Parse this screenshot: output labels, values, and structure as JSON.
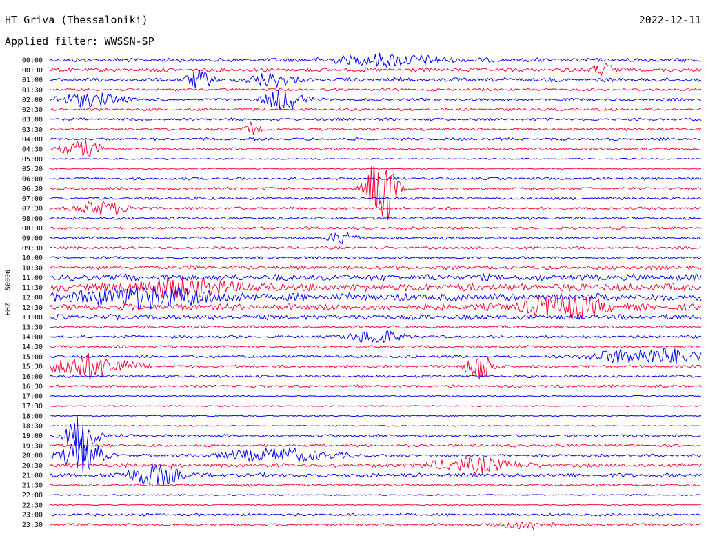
{
  "header": {
    "station": "HT Griva (Thessaloniki)",
    "date": "2022-12-11",
    "filter": "Applied filter: WWSSN-SP"
  },
  "chart_data": {
    "type": "line",
    "title": "HT Griva (Thessaloniki)",
    "subtitle": "Applied filter: WWSSN-SP",
    "date": "2022-12-11",
    "ylabel": "HHZ - 50000",
    "xlabel": "",
    "grid": false,
    "colors": [
      "#0000ff",
      "#ff0033"
    ],
    "rows": [
      "00:00",
      "00:30",
      "01:00",
      "01:30",
      "02:00",
      "02:30",
      "03:00",
      "03:30",
      "04:00",
      "04:30",
      "05:00",
      "05:30",
      "06:00",
      "06:30",
      "07:00",
      "07:30",
      "08:00",
      "08:30",
      "09:00",
      "09:30",
      "10:00",
      "10:30",
      "11:00",
      "11:30",
      "12:00",
      "12:30",
      "13:00",
      "13:30",
      "14:00",
      "14:30",
      "15:00",
      "15:30",
      "16:00",
      "16:30",
      "17:00",
      "17:30",
      "18:00",
      "18:30",
      "19:00",
      "19:30",
      "20:00",
      "20:30",
      "21:00",
      "21:30",
      "22:00",
      "22:30",
      "23:00",
      "23:30"
    ],
    "noise_level": [
      3,
      3,
      3,
      2,
      2,
      2,
      2,
      2,
      2,
      2,
      1,
      1,
      2,
      2,
      2,
      2,
      2,
      2,
      2,
      2,
      2,
      3,
      5,
      6,
      6,
      5,
      4,
      2,
      2,
      2,
      2,
      2,
      2,
      2,
      1,
      1,
      1,
      1,
      2,
      2,
      2,
      3,
      3,
      2,
      1,
      1,
      2,
      2
    ],
    "events": [
      {
        "row": 0,
        "t": 0.52,
        "amp": 8,
        "width": 0.08
      },
      {
        "row": 1,
        "t": 0.85,
        "amp": 8,
        "width": 0.02
      },
      {
        "row": 2,
        "t": 0.23,
        "amp": 12,
        "width": 0.02
      },
      {
        "row": 2,
        "t": 0.34,
        "amp": 10,
        "width": 0.03
      },
      {
        "row": 4,
        "t": 0.06,
        "amp": 10,
        "width": 0.05
      },
      {
        "row": 4,
        "t": 0.36,
        "amp": 15,
        "width": 0.03
      },
      {
        "row": 7,
        "t": 0.31,
        "amp": 10,
        "width": 0.01
      },
      {
        "row": 9,
        "t": 0.05,
        "amp": 12,
        "width": 0.03
      },
      {
        "row": 13,
        "t": 0.51,
        "amp": 60,
        "width": 0.02
      },
      {
        "row": 15,
        "t": 0.08,
        "amp": 10,
        "width": 0.04
      },
      {
        "row": 18,
        "t": 0.45,
        "amp": 10,
        "width": 0.02
      },
      {
        "row": 23,
        "t": 0.2,
        "amp": 12,
        "width": 0.08
      },
      {
        "row": 24,
        "t": 0.15,
        "amp": 14,
        "width": 0.1
      },
      {
        "row": 25,
        "t": 0.79,
        "amp": 16,
        "width": 0.06
      },
      {
        "row": 28,
        "t": 0.5,
        "amp": 10,
        "width": 0.04
      },
      {
        "row": 30,
        "t": 0.88,
        "amp": 10,
        "width": 0.05
      },
      {
        "row": 30,
        "t": 0.96,
        "amp": 10,
        "width": 0.05
      },
      {
        "row": 31,
        "t": 0.06,
        "amp": 18,
        "width": 0.06
      },
      {
        "row": 31,
        "t": 0.66,
        "amp": 22,
        "width": 0.02
      },
      {
        "row": 38,
        "t": 0.05,
        "amp": 40,
        "width": 0.02
      },
      {
        "row": 40,
        "t": 0.05,
        "amp": 25,
        "width": 0.03
      },
      {
        "row": 40,
        "t": 0.35,
        "amp": 10,
        "width": 0.08
      },
      {
        "row": 41,
        "t": 0.65,
        "amp": 10,
        "width": 0.06
      },
      {
        "row": 42,
        "t": 0.16,
        "amp": 15,
        "width": 0.04
      },
      {
        "row": 47,
        "t": 0.73,
        "amp": 6,
        "width": 0.04
      }
    ]
  }
}
